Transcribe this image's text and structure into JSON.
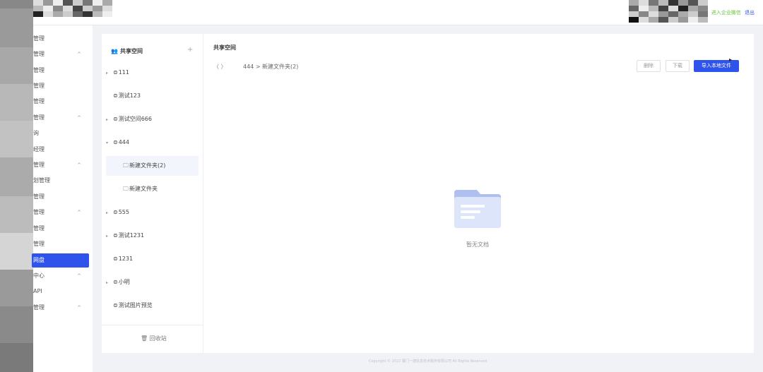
{
  "header": {
    "links": {
      "left_text": "进入企业微信",
      "logout": "退出"
    }
  },
  "sidebar": {
    "items": [
      {
        "label": "管理",
        "arrow": ""
      },
      {
        "label": "管理",
        "arrow": "^"
      },
      {
        "label": "管理",
        "arrow": ""
      },
      {
        "label": "管理",
        "arrow": ""
      },
      {
        "label": "管理",
        "arrow": ""
      },
      {
        "label": "管理",
        "arrow": "^"
      },
      {
        "label": "询",
        "arrow": ""
      },
      {
        "label": "经理",
        "arrow": ""
      },
      {
        "label": "管理",
        "arrow": "^"
      },
      {
        "label": "划管理",
        "arrow": ""
      },
      {
        "label": "管理",
        "arrow": ""
      },
      {
        "label": "管理",
        "arrow": "^"
      },
      {
        "label": "管理",
        "arrow": ""
      },
      {
        "label": "管理",
        "arrow": ""
      },
      {
        "label": "网盘",
        "arrow": "",
        "active": true
      },
      {
        "label": "中心",
        "arrow": "^"
      },
      {
        "label": "API",
        "arrow": ""
      },
      {
        "label": "管理",
        "arrow": "^"
      }
    ]
  },
  "tree": {
    "title": "共享空间",
    "title_icon": "people-icon",
    "add_symbol": "+",
    "nodes": [
      {
        "label": "111",
        "caret": "▸"
      },
      {
        "label": "测试123",
        "caret": ""
      },
      {
        "label": "测试空间666",
        "caret": "▸"
      },
      {
        "label": "444",
        "caret": "▾"
      },
      {
        "label": "新建文件夹(2)",
        "caret": "",
        "folder": true,
        "selected": true
      },
      {
        "label": "新建文件夹",
        "caret": "",
        "folder": true
      },
      {
        "label": "555",
        "caret": "▸"
      },
      {
        "label": "测试1231",
        "caret": "▸"
      },
      {
        "label": "1231",
        "caret": ""
      },
      {
        "label": "小明",
        "caret": "▸"
      },
      {
        "label": "测试图片预览",
        "caret": ""
      }
    ],
    "recycle": "回收站"
  },
  "content": {
    "title": "共享空间",
    "nav": "〈 〉",
    "breadcrumb": "444 > 新建文件夹(2)",
    "buttons": {
      "delete": "删除",
      "download": "下载",
      "import": "导入本地文件"
    },
    "empty_text": "暂无文档"
  },
  "footer": {
    "copyright": "Copyright © 2022 厦门一捷信息技术服务有限公司 All Rights Reserved"
  },
  "colors": {
    "accent": "#2f54eb",
    "green": "#67c23a"
  }
}
